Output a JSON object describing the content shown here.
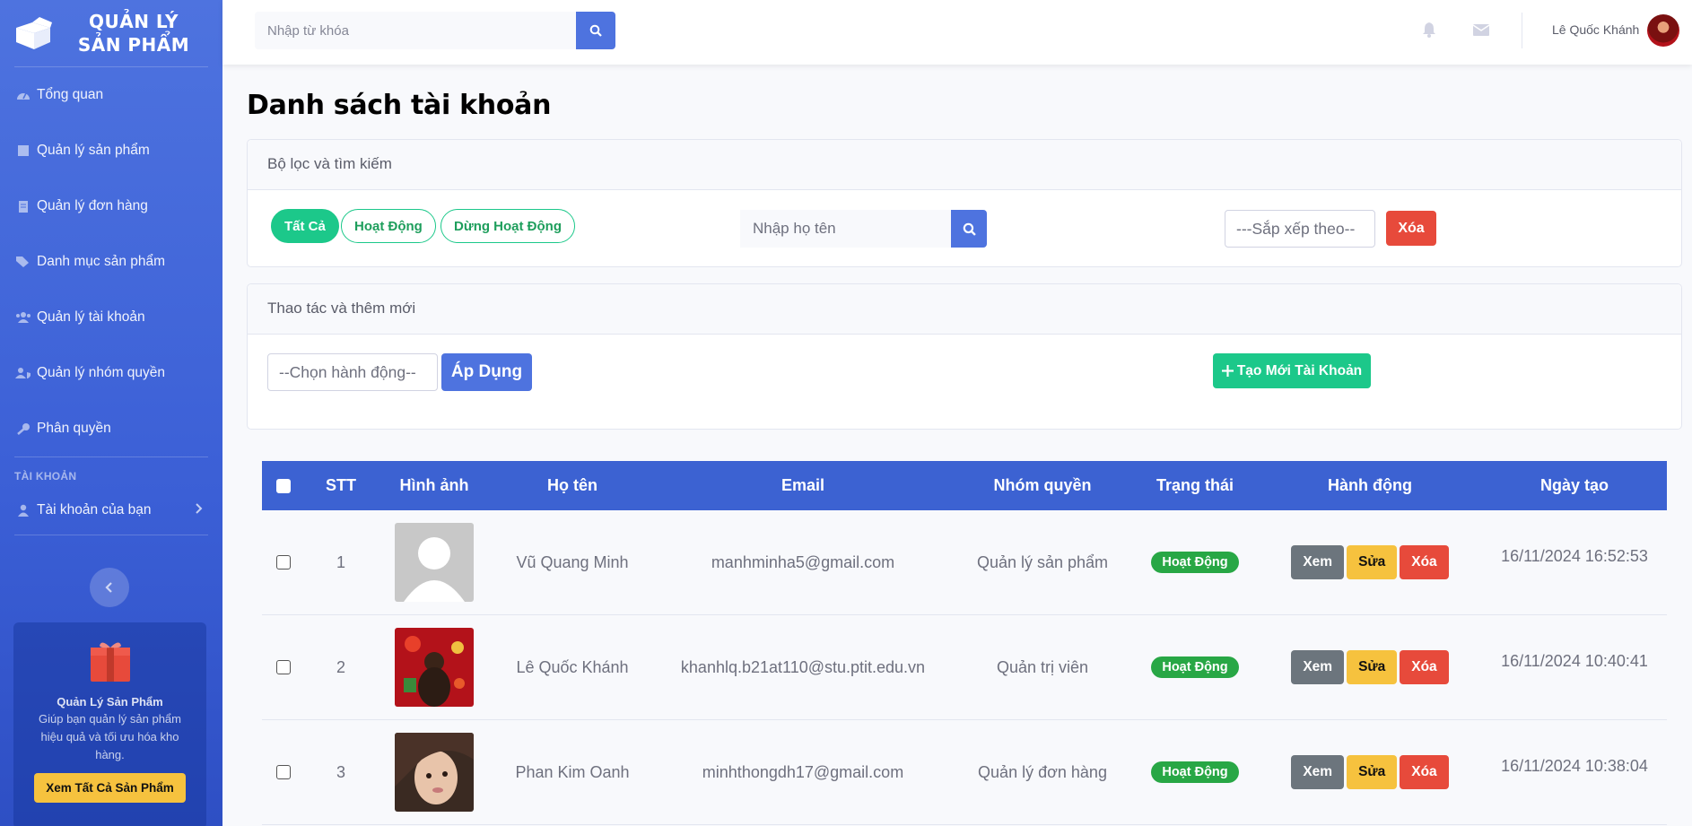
{
  "sidebar": {
    "brand_line1": "QUẢN LÝ",
    "brand_line2": "SẢN PHẨM",
    "items": [
      {
        "label": "Tổng quan"
      },
      {
        "label": "Quản lý sản phẩm"
      },
      {
        "label": "Quản lý đơn hàng"
      },
      {
        "label": "Danh mục sản phẩm"
      },
      {
        "label": "Quản lý tài khoản"
      },
      {
        "label": "Quản lý nhóm quyền"
      },
      {
        "label": "Phân quyền"
      }
    ],
    "heading": "TÀI KHOẢN",
    "account_item": "Tài khoản của bạn",
    "promo": {
      "title": "Quản Lý Sản Phẩm",
      "desc": "Giúp bạn quản lý sản phẩm hiệu quả và tối ưu hóa kho hàng.",
      "button": "Xem Tất Cả Sản Phẩm"
    }
  },
  "topbar": {
    "search_placeholder": "Nhập từ khóa",
    "user_name": "Lê Quốc Khánh"
  },
  "page": {
    "title": "Danh sách tài khoản",
    "filter_card": {
      "header": "Bộ lọc và tìm kiếm",
      "filters": [
        "Tất Cả",
        "Hoạt Động",
        "Dừng Hoạt Động"
      ],
      "name_placeholder": "Nhập họ tên",
      "sort_placeholder": "---Sắp xếp theo--",
      "clear_label": "Xóa"
    },
    "action_card": {
      "header": "Thao tác và thêm mới",
      "action_select": "--Chọn hành động--",
      "apply_label": "Áp Dụng",
      "create_label": "Tạo Mới Tài Khoản"
    }
  },
  "table": {
    "headers": [
      "STT",
      "Hình ảnh",
      "Họ tên",
      "Email",
      "Nhóm quyền",
      "Trạng thái",
      "Hành động",
      "Ngày tạo"
    ],
    "rows": [
      {
        "stt": "1",
        "name": "Vũ Quang Minh",
        "email": "manhminha5@gmail.com",
        "group": "Quản lý sản phẩm",
        "status": "Hoạt Động",
        "date": "16/11/2024 16:52:53"
      },
      {
        "stt": "2",
        "name": "Lê Quốc Khánh",
        "email": "khanhlq.b21at110@stu.ptit.edu.vn",
        "group": "Quản trị viên",
        "status": "Hoạt Động",
        "date": "16/11/2024 10:40:41"
      },
      {
        "stt": "3",
        "name": "Phan Kim Oanh",
        "email": "minhthongdh17@gmail.com",
        "group": "Quản lý đơn hàng",
        "status": "Hoạt Động",
        "date": "16/11/2024 10:38:04"
      }
    ],
    "actions": {
      "view": "Xem",
      "edit": "Sửa",
      "delete": "Xóa"
    }
  }
}
